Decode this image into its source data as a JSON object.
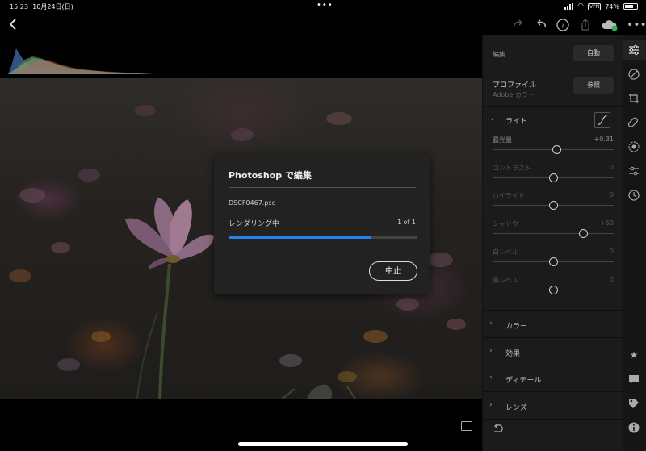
{
  "status_bar": {
    "time": "15:23",
    "date": "10月24日(日)",
    "vpn": "VPN",
    "battery": "74%",
    "battery_level": 0.74
  },
  "toolbar": {
    "back_icon": "chevron-left-icon"
  },
  "panel": {
    "edit_label": "編集",
    "auto_button": "自動",
    "profile_title": "プロファイル",
    "profile_value": "Adobe カラー",
    "browse_button": "参照",
    "light_section": "ライト",
    "sliders": [
      {
        "name": "露光量",
        "value": "+0.31",
        "position": 0.53,
        "enabled": true
      },
      {
        "name": "コントラスト",
        "value": "0",
        "position": 0.5,
        "enabled": false
      },
      {
        "name": "ハイライト",
        "value": "0",
        "position": 0.5,
        "enabled": false
      },
      {
        "name": "シャドウ",
        "value": "+50",
        "position": 0.75,
        "enabled": false
      },
      {
        "name": "白レベル",
        "value": "0",
        "position": 0.5,
        "enabled": false
      },
      {
        "name": "黒レベル",
        "value": "0",
        "position": 0.5,
        "enabled": false
      }
    ],
    "sections": [
      "カラー",
      "効果",
      "ディテール",
      "レンズ"
    ]
  },
  "dialog": {
    "title": "Photoshop で編集",
    "file_name": "DSCF0467.psd",
    "status": "レンダリング中",
    "count": "1 of 1",
    "progress": 0.75,
    "cancel_button": "中止"
  },
  "colors": {
    "accent": "#2680eb",
    "panel_bg": "#1b1b1b",
    "dialog_bg": "#222222"
  }
}
